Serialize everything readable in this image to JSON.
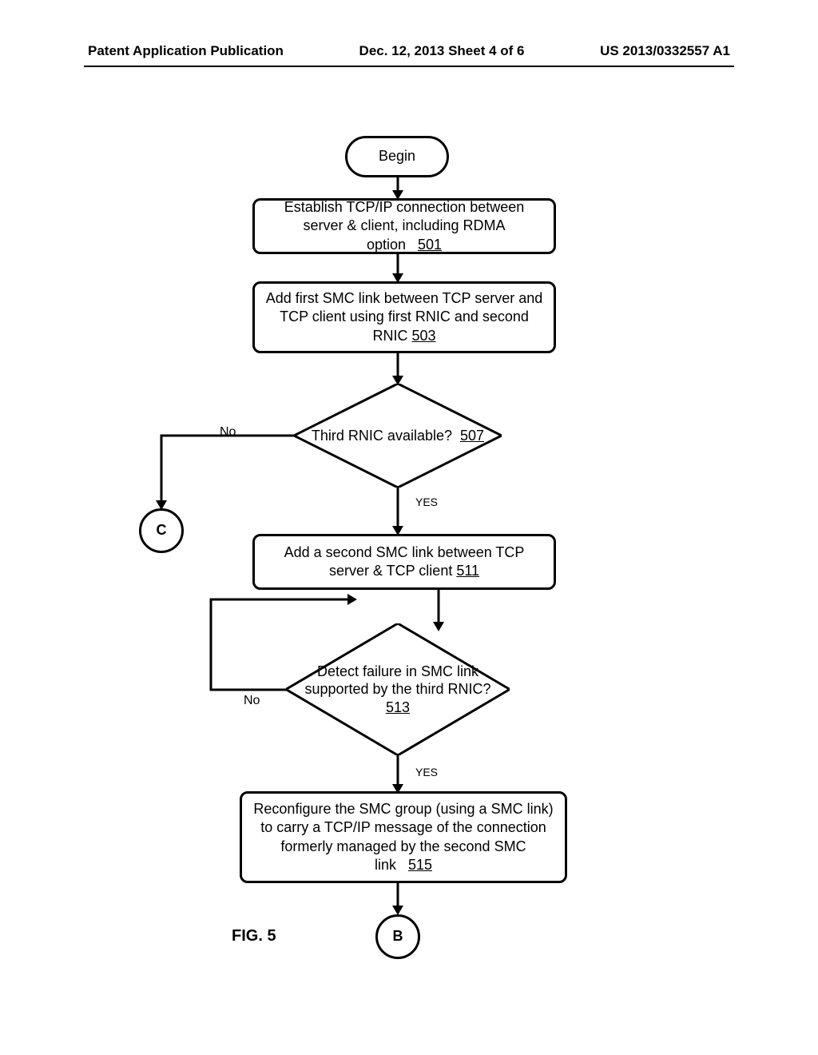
{
  "header": {
    "left": "Patent Application Publication",
    "center": "Dec. 12, 2013  Sheet 4 of 6",
    "right": "US 2013/0332557 A1"
  },
  "nodes": {
    "begin": "Begin",
    "step501_text": "Establish TCP/IP connection between server & client, including RDMA option",
    "step501_ref": "501",
    "step503_text": "Add first SMC link between TCP server and TCP client using first RNIC and second RNIC",
    "step503_ref": "503",
    "dec507_text": "Third RNIC available?",
    "dec507_ref": "507",
    "connC": "C",
    "step511_text": "Add a second SMC link between TCP server & TCP client",
    "step511_ref": "511",
    "dec513_text": "Detect failure in SMC link supported by the third RNIC?",
    "dec513_ref": "513",
    "step515_text": "Reconfigure the SMC group (using a SMC link) to carry a TCP/IP message of the connection formerly managed by the second SMC link",
    "step515_ref": "515",
    "connB": "B"
  },
  "labels": {
    "no1": "No",
    "yes1": "YES",
    "no2": "No",
    "yes2": "YES",
    "figure": "FIG. 5"
  }
}
